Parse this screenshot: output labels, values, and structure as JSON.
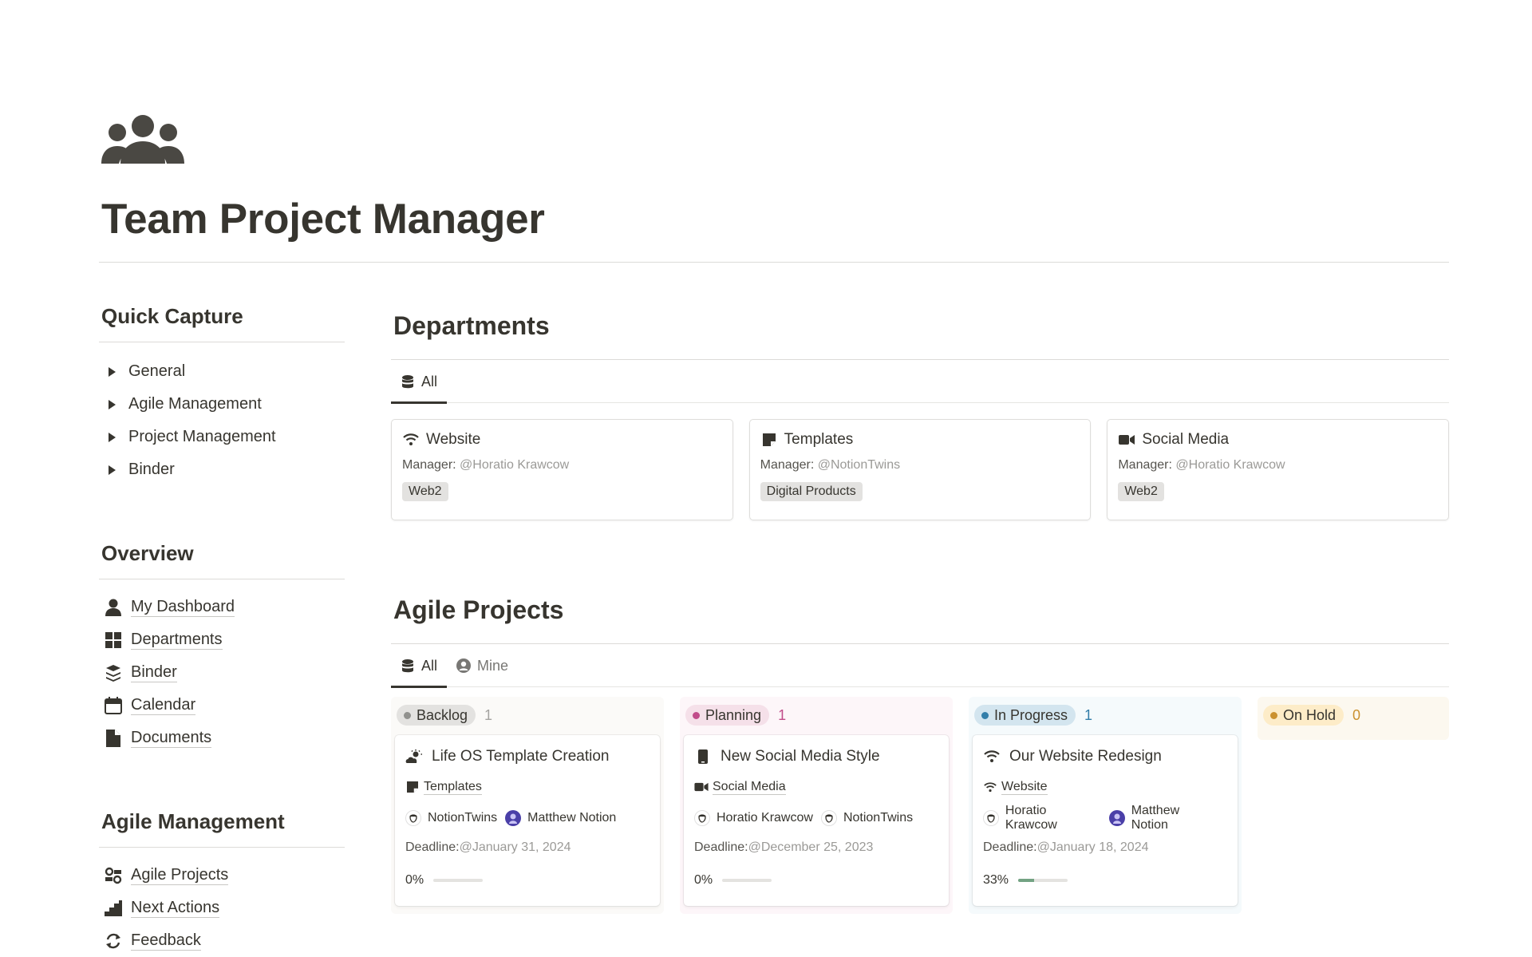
{
  "page": {
    "title": "Team Project Manager",
    "icon": "team-people-icon"
  },
  "quick_capture": {
    "heading": "Quick Capture",
    "items": [
      {
        "label": "General"
      },
      {
        "label": "Agile Management"
      },
      {
        "label": "Project Management"
      },
      {
        "label": "Binder"
      }
    ]
  },
  "overview": {
    "heading": "Overview",
    "items": [
      {
        "label": "My Dashboard",
        "icon": "person-icon"
      },
      {
        "label": "Departments",
        "icon": "grid-icon"
      },
      {
        "label": "Binder",
        "icon": "layers-icon"
      },
      {
        "label": "Calendar",
        "icon": "calendar-icon"
      },
      {
        "label": "Documents",
        "icon": "document-icon"
      }
    ]
  },
  "agile_management": {
    "heading": "Agile Management",
    "items": [
      {
        "label": "Agile Projects",
        "icon": "agile-icon"
      },
      {
        "label": "Next Actions",
        "icon": "stairs-icon"
      },
      {
        "label": "Feedback",
        "icon": "refresh-icon"
      }
    ]
  },
  "departments": {
    "title": "Departments",
    "tabs": [
      {
        "label": "All",
        "icon": "database-icon"
      }
    ],
    "manager_label": "Manager:",
    "cards": [
      {
        "name": "Website",
        "icon": "wifi-icon",
        "manager": "@Horatio Krawcow",
        "tag": "Web2"
      },
      {
        "name": "Templates",
        "icon": "sticky-note-icon",
        "manager": "@NotionTwins",
        "tag": "Digital Products"
      },
      {
        "name": "Social Media",
        "icon": "video-camera-icon",
        "manager": "@Horatio Krawcow",
        "tag": "Web2"
      }
    ]
  },
  "agile_projects": {
    "title": "Agile Projects",
    "tabs": [
      {
        "label": "All",
        "icon": "database-icon"
      },
      {
        "label": "Mine",
        "icon": "user-circle-icon"
      }
    ],
    "deadline_label": "Deadline:",
    "columns": [
      {
        "status": "Backlog",
        "count": "1",
        "colors": {
          "bg": "#fbfaf8",
          "pill": "#e3e2e0",
          "dot": "#91918e",
          "count": "#a5a4a1"
        },
        "card": {
          "title": "Life OS Template Creation",
          "icon": "sun-cloud-icon",
          "relation": "Templates",
          "relation_icon": "sticky-note-icon",
          "people": [
            {
              "name": "NotionTwins",
              "avatar": "sketch"
            },
            {
              "name": "Matthew Notion",
              "avatar": "purple"
            }
          ],
          "deadline": "@January 31, 2024",
          "progress_label": "0%",
          "progress": 0
        }
      },
      {
        "status": "Planning",
        "count": "1",
        "colors": {
          "bg": "#fdf6f9",
          "pill": "#f5e0e9",
          "dot": "#c14c8a",
          "count": "#c14c8a"
        },
        "card": {
          "title": "New Social Media Style",
          "icon": "phone-icon",
          "relation": "Social Media",
          "relation_icon": "video-camera-icon",
          "people": [
            {
              "name": "Horatio Krawcow",
              "avatar": "sketch"
            },
            {
              "name": "NotionTwins",
              "avatar": "sketch"
            }
          ],
          "deadline": "@December 25, 2023",
          "progress_label": "0%",
          "progress": 0
        }
      },
      {
        "status": "In Progress",
        "count": "1",
        "colors": {
          "bg": "#f5fafc",
          "pill": "#d3e5ef",
          "dot": "#337ea9",
          "count": "#337ea9"
        },
        "card": {
          "title": "Our Website Redesign",
          "icon": "wifi-icon",
          "relation": "Website",
          "relation_icon": "wifi-icon",
          "people": [
            {
              "name": "Horatio Krawcow",
              "avatar": "sketch"
            },
            {
              "name": "Matthew Notion",
              "avatar": "purple"
            }
          ],
          "deadline": "@January 18, 2024",
          "progress_label": "33%",
          "progress": 0.33
        }
      },
      {
        "status": "On Hold",
        "count": "0",
        "colors": {
          "bg": "#fcf8ef",
          "pill": "#fdecc8",
          "dot": "#cb912f",
          "count": "#cb912f"
        }
      }
    ]
  }
}
